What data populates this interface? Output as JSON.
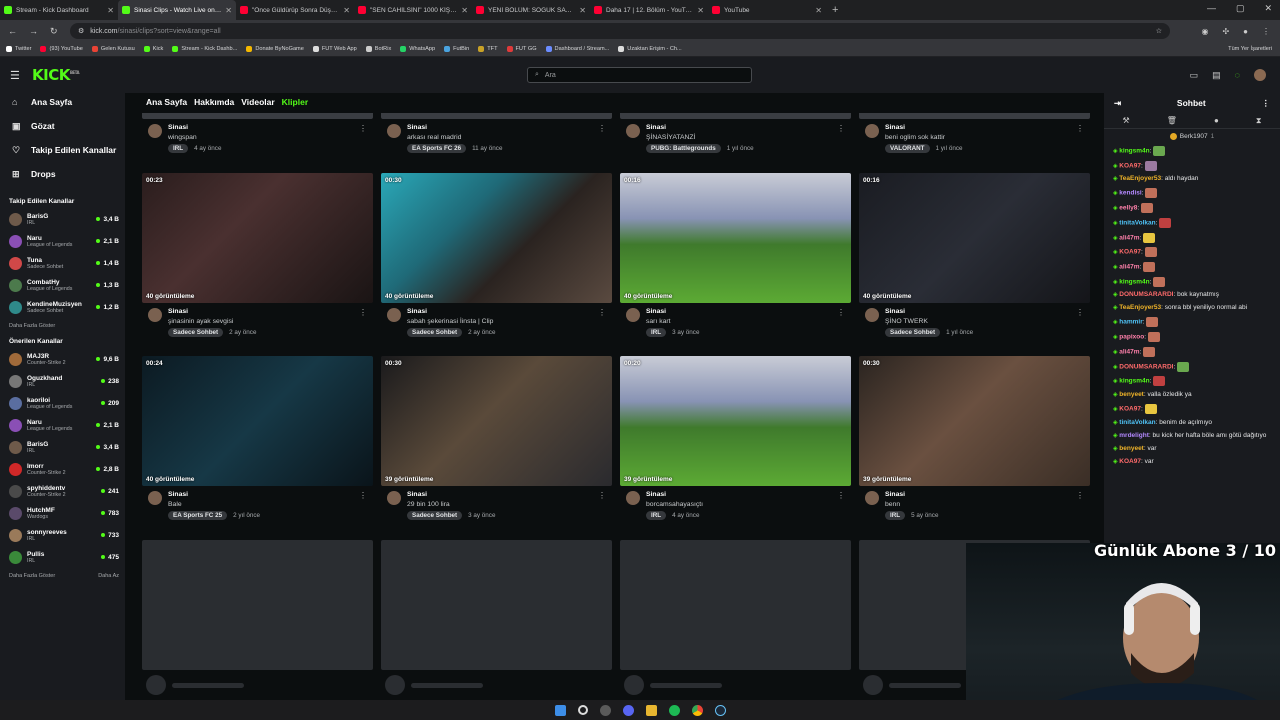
{
  "browser": {
    "tabs": [
      {
        "label": "Stream - Kick Dashboard",
        "color": "#53fc18",
        "active": false
      },
      {
        "label": "Sinasi Clips - Watch Live on Kick",
        "color": "#53fc18",
        "active": true
      },
      {
        "label": "\"Önce Güldürüp Sonra Düşündür",
        "color": "#ff0033",
        "active": false
      },
      {
        "label": "\"SEN CAHİLSİNİ\" 1000 KİŞİ İLE",
        "color": "#ff0033",
        "active": false
      },
      {
        "label": "YENİ BÖLÜM: SOĞUK SAVAŞ EI",
        "color": "#ff0033",
        "active": false
      },
      {
        "label": "Daha 17 | 12. Bölüm - YouTube",
        "color": "#ff0033",
        "active": false
      },
      {
        "label": "YouTube",
        "color": "#ff0033",
        "active": false
      }
    ],
    "url_host": "kick.com",
    "url_path": "/sinasi/clips?sort=view&range=all",
    "bookmarks": [
      {
        "label": "Twitter",
        "color": "#ffffff"
      },
      {
        "label": "(93) YouTube",
        "color": "#ff0033"
      },
      {
        "label": "Gelen Kutusu",
        "color": "#ea4335"
      },
      {
        "label": "Kick",
        "color": "#53fc18"
      },
      {
        "label": "Stream - Kick Dashb...",
        "color": "#53fc18"
      },
      {
        "label": "Donate ByNoGame",
        "color": "#f5b800"
      },
      {
        "label": "FUT Web App",
        "color": "#dddddd"
      },
      {
        "label": "BotRix",
        "color": "#cccccc"
      },
      {
        "label": "WhatsApp",
        "color": "#25d366"
      },
      {
        "label": "FutBin",
        "color": "#4aa3df"
      },
      {
        "label": "TFT",
        "color": "#c9a227"
      },
      {
        "label": "FUT GG",
        "color": "#e03a3a"
      },
      {
        "label": "Dashboard / Stream...",
        "color": "#6b8cff"
      },
      {
        "label": "Uzaktan Erişim - Ch...",
        "color": "#dddddd"
      }
    ],
    "all_bookmarks": "Tüm Yer İşaretleri"
  },
  "header": {
    "logo": "KICK",
    "logo_sup": "BETA",
    "search_placeholder": "Ara"
  },
  "sidebar": {
    "nav": [
      {
        "label": "Ana Sayfa",
        "icon": "home-icon",
        "glyph": "⌂"
      },
      {
        "label": "Gözat",
        "icon": "browse-icon",
        "glyph": "▣"
      },
      {
        "label": "Takip Edilen Kanallar",
        "icon": "heart-icon",
        "glyph": "♡"
      },
      {
        "label": "Drops",
        "icon": "gift-icon",
        "glyph": "⊞"
      }
    ],
    "followed_title": "Takip Edilen Kanallar",
    "followed": [
      {
        "name": "BarisG",
        "category": "IRL",
        "viewers": "3,4 B",
        "color": "#6e5a4a"
      },
      {
        "name": "Naru",
        "category": "League of Legends",
        "viewers": "2,1 B",
        "color": "#8a4fb5"
      },
      {
        "name": "Tuna",
        "category": "Sadece Sohbet",
        "viewers": "1,4 B",
        "color": "#d04848"
      },
      {
        "name": "CombatHy",
        "category": "League of Legends",
        "viewers": "1,3 B",
        "color": "#4c7a4c"
      },
      {
        "name": "KendineMuzisyen",
        "category": "Sadece Sohbet",
        "viewers": "1,2 B",
        "color": "#2f8a8a"
      }
    ],
    "followed_more": "Daha Fazla Göster",
    "recommended_title": "Önerilen Kanallar",
    "recommended": [
      {
        "name": "MAJ3R",
        "category": "Counter-Strike 2",
        "viewers": "9,6 B",
        "color": "#a06a3a"
      },
      {
        "name": "Oguzkhand",
        "category": "IRL",
        "viewers": "238",
        "color": "#777777"
      },
      {
        "name": "kaoriloi",
        "category": "League of Legends",
        "viewers": "209",
        "color": "#5a6ea0"
      },
      {
        "name": "Naru",
        "category": "League of Legends",
        "viewers": "2,1 B",
        "color": "#8a4fb5"
      },
      {
        "name": "BarisG",
        "category": "IRL",
        "viewers": "3,4 B",
        "color": "#6e5a4a"
      },
      {
        "name": "Imorr",
        "category": "Counter-Strike 2",
        "viewers": "2,8 B",
        "color": "#d02828"
      },
      {
        "name": "spyhiddentv",
        "category": "Counter-Strike 2",
        "viewers": "241",
        "color": "#4a4a4a"
      },
      {
        "name": "HutchMF",
        "category": "Wardogs",
        "viewers": "783",
        "color": "#5a4a6a"
      },
      {
        "name": "sonnyreeves",
        "category": "IRL",
        "viewers": "733",
        "color": "#9a7a5a"
      },
      {
        "name": "Pullis",
        "category": "IRL",
        "viewers": "475",
        "color": "#3a8a3a"
      }
    ],
    "rec_more": "Daha Fazla Göster",
    "rec_less": "Daha Az"
  },
  "main": {
    "tabs": [
      {
        "label": "Ana Sayfa",
        "active": false
      },
      {
        "label": "Hakkımda",
        "active": false
      },
      {
        "label": "Videolar",
        "active": false
      },
      {
        "label": "Klipler",
        "active": true
      }
    ],
    "top_row": [
      {
        "channel": "Sinasi",
        "title": "wingspan",
        "category": "IRL",
        "age": "4 ay önce"
      },
      {
        "channel": "Sinasi",
        "title": "arkası real madrid",
        "category": "EA Sports FC 26",
        "age": "11 ay önce"
      },
      {
        "channel": "Sinasi",
        "title": "ŞİNASİYATANZİ",
        "category": "PUBG: Battlegrounds",
        "age": "1 yıl önce"
      },
      {
        "channel": "Sinasi",
        "title": "beni oglim sok kattir",
        "category": "VALORANT",
        "age": "1 yıl önce"
      }
    ],
    "clips": [
      {
        "duration": "00:23",
        "views": "40 görüntüleme",
        "channel": "Sinasi",
        "title": "şinasinin ayak sevgisi",
        "category": "Sadece Sohbet",
        "age": "2 ay önce",
        "bg": "linear-gradient(135deg,#2a1d1d 0%,#4a3030 40%,#1a1414 100%)"
      },
      {
        "duration": "00:30",
        "views": "40 görüntüleme",
        "channel": "Sinasi",
        "title": "sabah şekerinasi İinsta | Clip",
        "category": "Sadece Sohbet",
        "age": "2 ay önce",
        "bg": "linear-gradient(135deg,#2aa8b8 0%,#1f6a78 35%,#2a2320 60%,#5a4a40 100%)"
      },
      {
        "duration": "00:16",
        "views": "40 görüntüleme",
        "channel": "Sinasi",
        "title": "sarı kart",
        "category": "IRL",
        "age": "3 ay önce",
        "bg": "linear-gradient(180deg,#c9ccd6 0%,#8893b4 35%,#3f7a2c 55%,#5caa34 100%)"
      },
      {
        "duration": "00:16",
        "views": "40 görüntüleme",
        "channel": "Sinasi",
        "title": "ŞİNO TWERK",
        "category": "Sadece Sohbet",
        "age": "1 yıl önce",
        "bg": "linear-gradient(135deg,#1a1c22 0%,#2a2d36 50%,#141519 100%)"
      },
      {
        "duration": "00:24",
        "views": "40 görüntüleme",
        "channel": "Sinasi",
        "title": "Bale",
        "category": "EA Sports FC 25",
        "age": "2 yıl önce",
        "bg": "linear-gradient(135deg,#0c1a22 0%,#163846 50%,#0a141a 100%)"
      },
      {
        "duration": "00:30",
        "views": "39 görüntüleme",
        "channel": "Sinasi",
        "title": "29 bin 100 lira",
        "category": "Sadece Sohbet",
        "age": "3 ay önce",
        "bg": "linear-gradient(135deg,#1a1a1c 0%,#5a4a3a 45%,#2a2a2e 100%)"
      },
      {
        "duration": "00:20",
        "views": "39 görüntüleme",
        "channel": "Sinasi",
        "title": "borcamsahayasıçtı",
        "category": "IRL",
        "age": "4 ay önce",
        "bg": "linear-gradient(180deg,#c9ccd6 0%,#8893b4 35%,#3f7a2c 55%,#5caa34 100%)"
      },
      {
        "duration": "00:30",
        "views": "39 görüntüleme",
        "channel": "Sinasi",
        "title": "benn",
        "category": "IRL",
        "age": "5 ay önce",
        "bg": "linear-gradient(135deg,#2a2420 0%,#6a5040 45%,#3a2e26 100%)"
      }
    ]
  },
  "chat": {
    "title": "Sohbet",
    "pinned_user": "Berk1907",
    "pinned_count": "1",
    "messages": [
      {
        "user": "kingsm4n",
        "text": "",
        "color": "#53fc18",
        "emote": "#6aa84f"
      },
      {
        "user": "KOA97",
        "text": "",
        "color": "#ff6b6b",
        "emote": "#9a7aa0"
      },
      {
        "user": "TeaEnjoyer53",
        "text": "aldı haydan",
        "color": "#f0b429",
        "emote": ""
      },
      {
        "user": "kendisi",
        "text": "",
        "color": "#b388ff",
        "emote": "#c0705a"
      },
      {
        "user": "eelly8",
        "text": "",
        "color": "#ff80ab",
        "emote": "#c0705a"
      },
      {
        "user": "tinitaVolkan",
        "text": "",
        "color": "#4fc3f7",
        "emote": "#c04040"
      },
      {
        "user": "ali47m",
        "text": "",
        "color": "#ff80ab",
        "emote": "#e8c640"
      },
      {
        "user": "KOA97",
        "text": "",
        "color": "#ff6b6b",
        "emote": "#c0705a"
      },
      {
        "user": "ali47m",
        "text": "",
        "color": "#ff80ab",
        "emote": "#c0705a"
      },
      {
        "user": "kingsm4n",
        "text": "",
        "color": "#53fc18",
        "emote": "#c0705a"
      },
      {
        "user": "DONUMSARARDI",
        "text": "bok kaynatmış",
        "color": "#ff6b6b",
        "emote": ""
      },
      {
        "user": "TeaEnjoyer53",
        "text": "sonra bbl yeniliyo normal abi",
        "color": "#f0b429",
        "emote": ""
      },
      {
        "user": "hammir",
        "text": "",
        "color": "#4fc3f7",
        "emote": "#c0705a"
      },
      {
        "user": "papixoo",
        "text": "",
        "color": "#ff80ab",
        "emote": "#c0705a"
      },
      {
        "user": "ali47m",
        "text": "",
        "color": "#ff80ab",
        "emote": "#c0705a"
      },
      {
        "user": "DONUMSARARDI",
        "text": "",
        "color": "#ff6b6b",
        "emote": "#6aa84f"
      },
      {
        "user": "kingsm4n",
        "text": "",
        "color": "#53fc18",
        "emote": "#c04040"
      },
      {
        "user": "benyeet",
        "text": "valla özledik ya",
        "color": "#f0b429",
        "emote": ""
      },
      {
        "user": "KOA97",
        "text": "",
        "color": "#ff6b6b",
        "emote": "#e8c640"
      },
      {
        "user": "tinitaVolkan",
        "text": "benim de açılmıyo",
        "color": "#4fc3f7",
        "emote": ""
      },
      {
        "user": "mrdelight",
        "text": "bu kick her hafta böle amı götü dağıtıyo",
        "color": "#b388ff",
        "emote": ""
      },
      {
        "user": "benyeet",
        "text": "var",
        "color": "#f0b429",
        "emote": ""
      },
      {
        "user": "KOA97",
        "text": "var",
        "color": "#ff6b6b",
        "emote": ""
      }
    ]
  },
  "overlay": {
    "sub_goal": "Günlük Abone 3 / 10"
  }
}
